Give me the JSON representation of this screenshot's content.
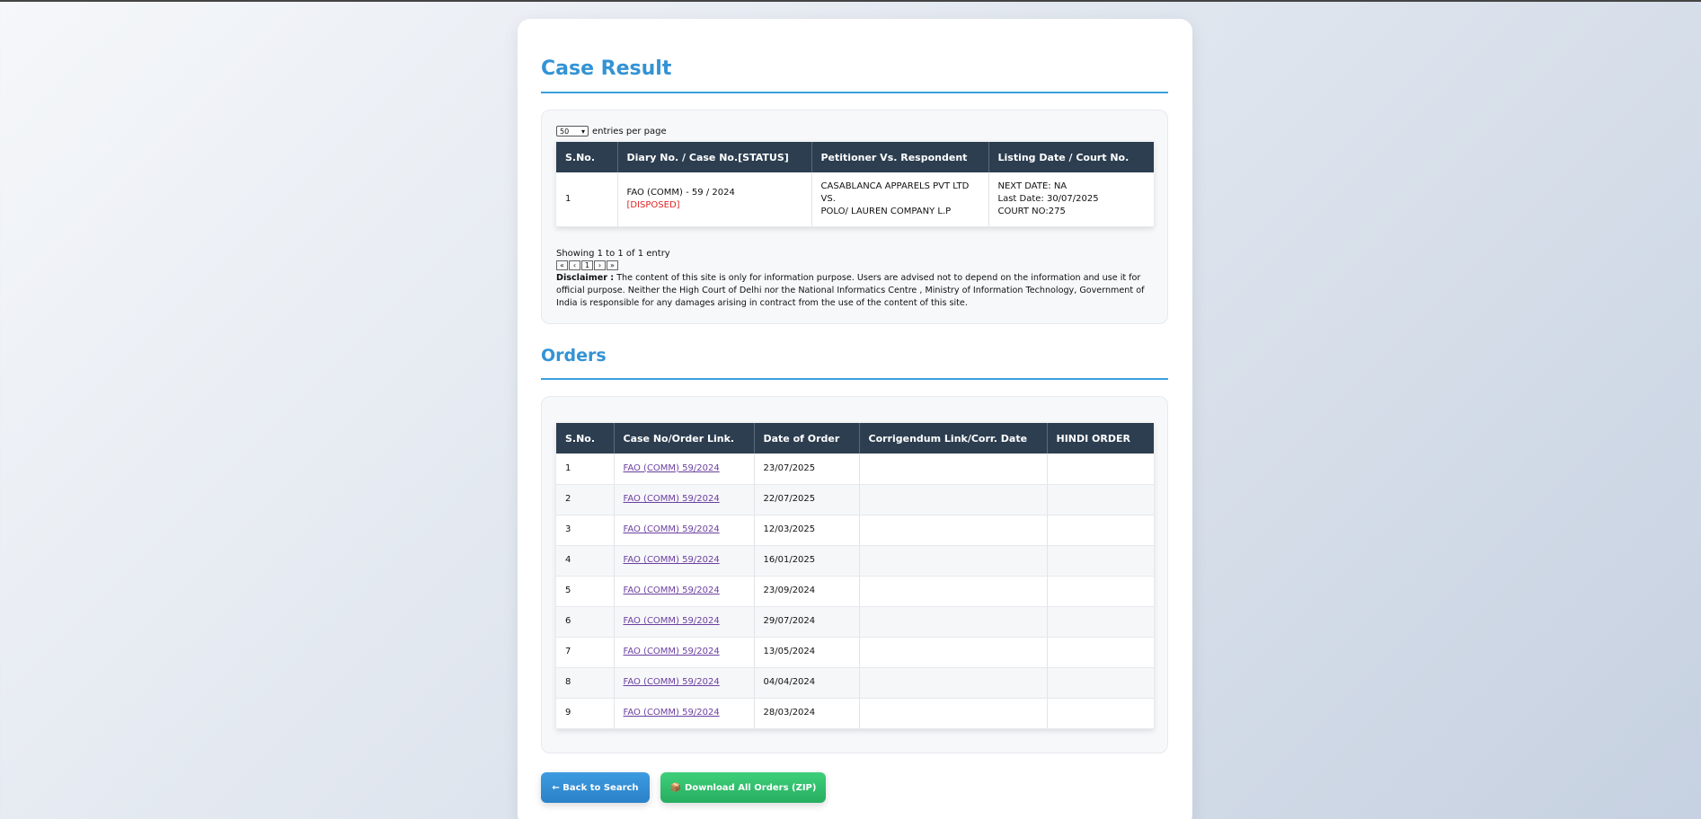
{
  "case_result": {
    "title": "Case Result",
    "entries_select_value": "50",
    "entries_label": "entries per page",
    "columns": [
      "S.No.",
      "Diary No. / Case No.[STATUS]",
      "Petitioner Vs. Respondent",
      "Listing Date / Court No."
    ],
    "row": {
      "sno": "1",
      "case_no": "FAO (COMM) - 59 / 2024",
      "status": "[DISPOSED]",
      "petitioner": "CASABLANCA APPARELS PVT LTD",
      "vs": "VS.",
      "respondent": "POLO/ LAUREN COMPANY L.P",
      "next_date": "NEXT DATE: NA",
      "last_date": "Last Date: 30/07/2025",
      "court_no": "COURT NO:275"
    },
    "showing": "Showing 1 to 1 of 1 entry",
    "pager": [
      "«",
      "‹",
      "1",
      "›",
      "»"
    ],
    "disclaimer_label": "Disclaimer :",
    "disclaimer_text": "The content of this site is only for information purpose. Users are advised not to depend on the information and use it for official purpose. Neither the High Court of Delhi nor the National Informatics Centre , Ministry of Information Technology, Government of India is responsible for any damages arising in contract from the use of the content of this site."
  },
  "orders": {
    "title": "Orders",
    "columns": [
      "S.No.",
      "Case No/Order Link.",
      "Date of Order",
      "Corrigendum Link/Corr. Date",
      "HINDI ORDER"
    ],
    "rows": [
      {
        "sno": "1",
        "link": "FAO (COMM) 59/2024",
        "date": "23/07/2025",
        "corr": "",
        "hindi": ""
      },
      {
        "sno": "2",
        "link": "FAO (COMM) 59/2024",
        "date": "22/07/2025",
        "corr": "",
        "hindi": ""
      },
      {
        "sno": "3",
        "link": "FAO (COMM) 59/2024",
        "date": "12/03/2025",
        "corr": "",
        "hindi": ""
      },
      {
        "sno": "4",
        "link": "FAO (COMM) 59/2024",
        "date": "16/01/2025",
        "corr": "",
        "hindi": ""
      },
      {
        "sno": "5",
        "link": "FAO (COMM) 59/2024",
        "date": "23/09/2024",
        "corr": "",
        "hindi": ""
      },
      {
        "sno": "6",
        "link": "FAO (COMM) 59/2024",
        "date": "29/07/2024",
        "corr": "",
        "hindi": ""
      },
      {
        "sno": "7",
        "link": "FAO (COMM) 59/2024",
        "date": "13/05/2024",
        "corr": "",
        "hindi": ""
      },
      {
        "sno": "8",
        "link": "FAO (COMM) 59/2024",
        "date": "04/04/2024",
        "corr": "",
        "hindi": ""
      },
      {
        "sno": "9",
        "link": "FAO (COMM) 59/2024",
        "date": "28/03/2024",
        "corr": "",
        "hindi": ""
      }
    ]
  },
  "buttons": {
    "back_label": "← Back to Search",
    "zip_icon": "📦",
    "zip_label": "Download All Orders (ZIP)"
  },
  "colors": {
    "accent": "#3393d4",
    "header_bg": "#2c3e50",
    "status_red": "#e02424",
    "back_button": "#2b82c8",
    "zip_button": "#27ae60"
  }
}
